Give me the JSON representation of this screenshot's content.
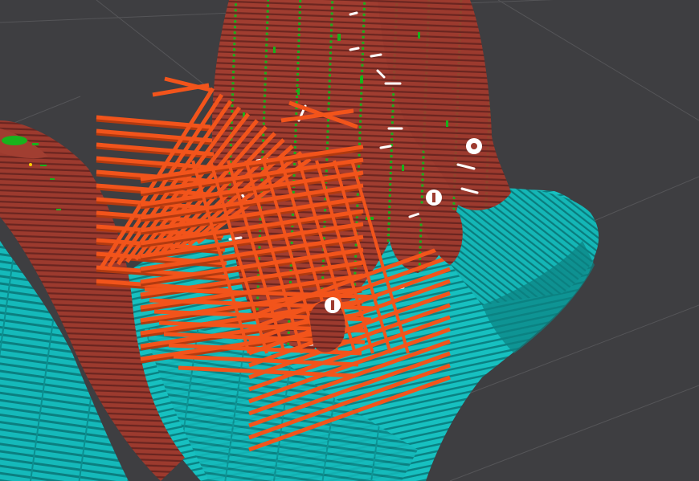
{
  "viewer": {
    "background_color": "#3e3e41",
    "grid_color": "#555558"
  },
  "legend_colors": {
    "perimeter": "#9d3b2f",
    "perimeter_shade": "#6e2620",
    "support_interface": "#13b8b8",
    "support_shade": "#0a7f80",
    "sparse_infill": "#f2541b",
    "infill_shade": "#b23a10",
    "seam": "#16b51b",
    "retraction_marker": "#ffffff"
  },
  "markers": [
    {
      "type": "retraction"
    },
    {
      "type": "retraction"
    },
    {
      "type": "retraction"
    }
  ]
}
